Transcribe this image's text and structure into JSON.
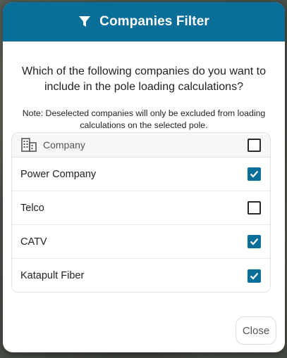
{
  "dialog": {
    "title": "Companies Filter",
    "icon": "filter-icon",
    "header_color": "#0a6f98",
    "question": "Which of the following companies do you want to include in the pole loading calculations?",
    "note": "Note: Deselected companies will only be excluded from loading calculations on the selected pole."
  },
  "table": {
    "column_label": "Company",
    "column_icon": "building-icon",
    "select_all_checked": false,
    "rows": [
      {
        "label": "Power Company",
        "checked": true
      },
      {
        "label": "Telco",
        "checked": false
      },
      {
        "label": "CATV",
        "checked": true
      },
      {
        "label": "Katapult Fiber",
        "checked": true
      }
    ]
  },
  "footer": {
    "close_label": "Close"
  }
}
